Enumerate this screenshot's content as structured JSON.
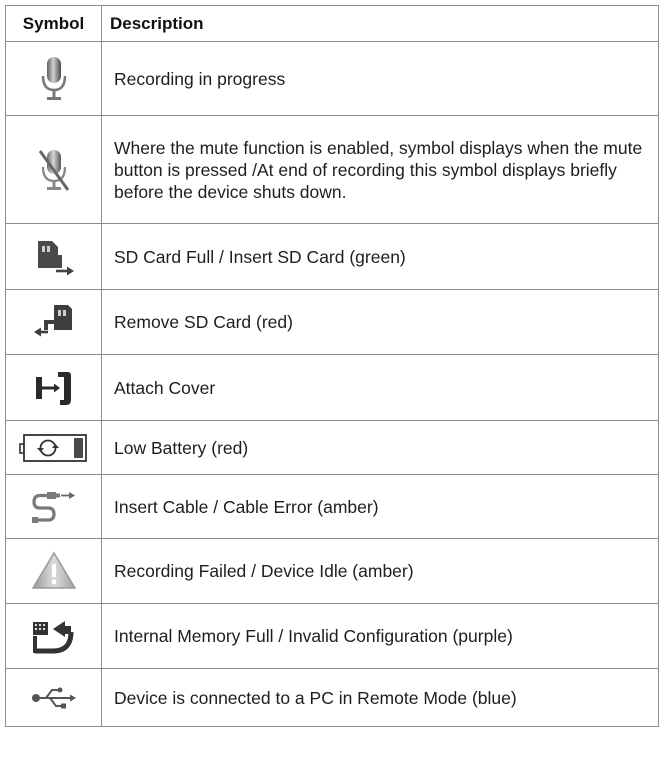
{
  "table": {
    "header": {
      "symbol": "Symbol",
      "description": "Description"
    },
    "rows": [
      {
        "icon": "microphone-icon",
        "description": "Recording in progress"
      },
      {
        "icon": "microphone-muted-icon",
        "description": "Where the mute function is enabled, symbol displays when the mute button is pressed /At end of recording this symbol displays briefly before the device shuts down."
      },
      {
        "icon": "sd-card-insert-icon",
        "description": "SD Card Full / Insert SD Card (green)"
      },
      {
        "icon": "sd-card-remove-icon",
        "description": "Remove SD Card (red)"
      },
      {
        "icon": "attach-cover-icon",
        "description": "Attach Cover"
      },
      {
        "icon": "low-battery-icon",
        "description": "Low Battery (red)"
      },
      {
        "icon": "cable-icon",
        "description": "Insert Cable / Cable Error (amber)"
      },
      {
        "icon": "warning-triangle-icon",
        "description": "Recording Failed / Device Idle (amber)"
      },
      {
        "icon": "memory-full-icon",
        "description": "Internal Memory Full / Invalid Configuration (purple)"
      },
      {
        "icon": "usb-icon",
        "description": "Device is connected to a PC in Remote Mode (blue)"
      }
    ]
  }
}
